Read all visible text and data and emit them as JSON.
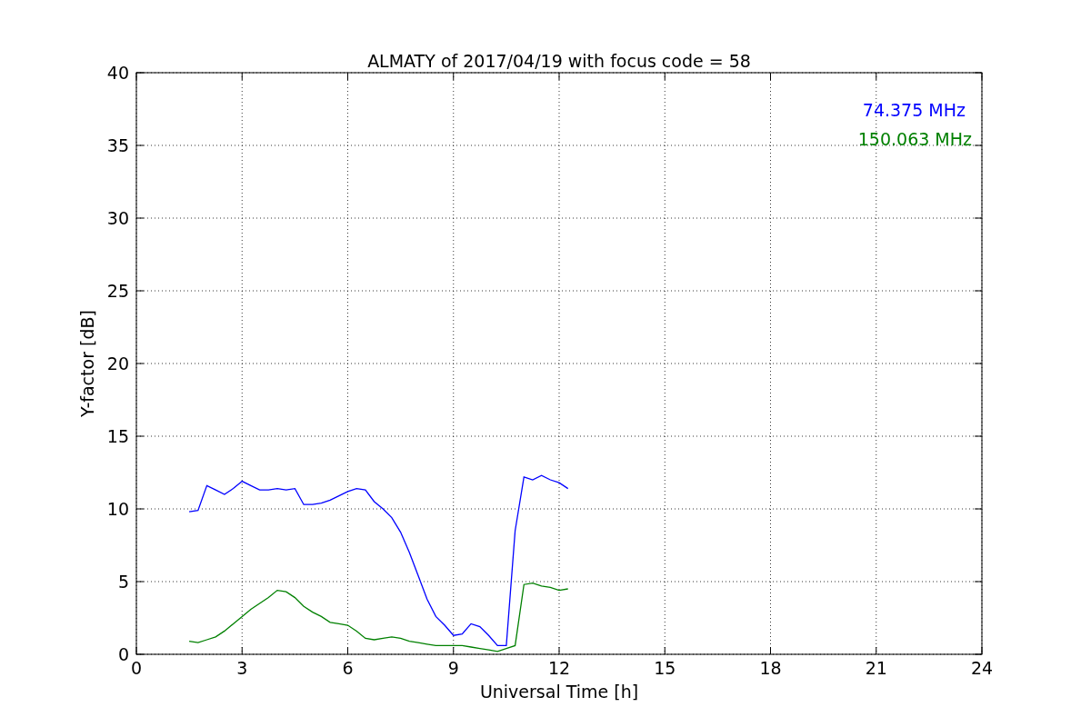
{
  "chart_data": {
    "type": "line",
    "title": "ALMATY of 2017/04/19 with focus code = 58",
    "xlabel": "Universal Time [h]",
    "ylabel": "Y-factor [dB]",
    "x": [
      1.5,
      1.75,
      2.0,
      2.25,
      2.5,
      2.75,
      3.0,
      3.25,
      3.5,
      3.75,
      4.0,
      4.25,
      4.5,
      4.75,
      5.0,
      5.25,
      5.5,
      5.75,
      6.0,
      6.25,
      6.5,
      6.75,
      7.0,
      7.25,
      7.5,
      7.75,
      8.0,
      8.25,
      8.5,
      8.75,
      9.0,
      9.25,
      9.5,
      9.75,
      10.0,
      10.25,
      10.5,
      10.75,
      11.0,
      11.25,
      11.5,
      11.75,
      12.0,
      12.25
    ],
    "series": [
      {
        "name": "74.375 MHz",
        "color": "#0000ff",
        "values": [
          9.8,
          9.9,
          11.6,
          11.3,
          11.0,
          11.4,
          11.9,
          11.6,
          11.3,
          11.3,
          11.4,
          11.3,
          11.4,
          10.3,
          10.3,
          10.4,
          10.6,
          10.9,
          11.2,
          11.4,
          11.3,
          10.5,
          10.0,
          9.4,
          8.4,
          7.0,
          5.4,
          3.8,
          2.6,
          2.0,
          1.3,
          1.4,
          2.1,
          1.9,
          1.3,
          0.6,
          0.6,
          8.5,
          12.2,
          12.0,
          12.3,
          12.0,
          11.8,
          11.4
        ]
      },
      {
        "name": "150.063 MHz",
        "color": "#008000",
        "values": [
          0.9,
          0.8,
          1.0,
          1.2,
          1.6,
          2.1,
          2.6,
          3.1,
          3.5,
          3.9,
          4.4,
          4.3,
          3.9,
          3.3,
          2.9,
          2.6,
          2.2,
          2.1,
          2.0,
          1.6,
          1.1,
          1.0,
          1.1,
          1.2,
          1.1,
          0.9,
          0.8,
          0.7,
          0.6,
          0.6,
          0.6,
          0.6,
          0.5,
          0.4,
          0.3,
          0.2,
          0.4,
          0.6,
          4.8,
          4.9,
          4.7,
          4.6,
          4.4,
          4.5
        ]
      }
    ],
    "xlim": [
      0,
      24
    ],
    "ylim": [
      0,
      40
    ],
    "xticks": [
      0,
      3,
      6,
      9,
      12,
      15,
      18,
      21,
      24
    ],
    "yticks": [
      0,
      5,
      10,
      15,
      20,
      25,
      30,
      35,
      40
    ],
    "grid": true
  }
}
